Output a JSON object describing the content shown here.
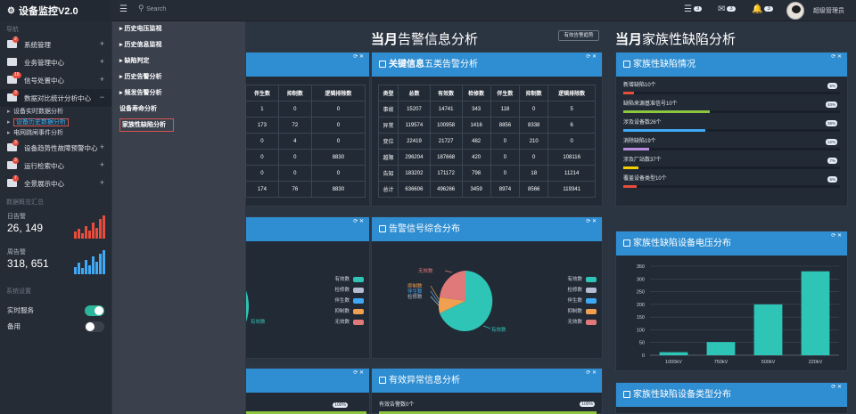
{
  "app": {
    "title": "设备监控V2.0",
    "search_placeholder": "Search"
  },
  "topbar": {
    "badges": [
      "3",
      "3",
      "3"
    ],
    "user": "超级管理员"
  },
  "sidebar": {
    "section_nav": "导航",
    "items": [
      {
        "label": "系统管理",
        "badge": "2"
      },
      {
        "label": "业务管理中心",
        "badge": ""
      },
      {
        "label": "信号处置中心",
        "badge": "15"
      },
      {
        "label": "数据对比统计分析中心",
        "badge": "3"
      }
    ],
    "subitems": [
      "设备实时数据分析",
      "设备历史数据分析",
      "电网跳闸事件分析"
    ],
    "items2": [
      {
        "label": "设备趋势性故障预警中心",
        "badge": "3"
      },
      {
        "label": "运行检索中心",
        "badge": "3"
      },
      {
        "label": "全景展示中心",
        "badge": "7"
      }
    ],
    "section_stats": "数据概览汇总",
    "stats": [
      {
        "label": "日告警",
        "value": "26, 149"
      },
      {
        "label": "周告警",
        "value": "318, 651"
      }
    ],
    "section_settings": "系统设置",
    "toggles": [
      {
        "label": "实时服务",
        "on": true
      },
      {
        "label": "备用",
        "on": false
      }
    ]
  },
  "dropdown": {
    "items": [
      "历史电压监视",
      "历史信息监视",
      "缺陷判定",
      "历史告警分析",
      "频发告警分析",
      "设备寿命分析",
      "家族性缺陷分析"
    ]
  },
  "left_panel": {
    "headers": [
      "伴生数",
      "抑制数",
      "逻辑排除数"
    ],
    "rows": [
      [
        "1",
        "0",
        "0"
      ],
      [
        "173",
        "72",
        "0"
      ],
      [
        "0",
        "4",
        "0"
      ],
      [
        "0",
        "0",
        "8830"
      ],
      [
        "0",
        "0",
        "0"
      ],
      [
        "174",
        "76",
        "8830"
      ]
    ],
    "bottom_pct": "100%",
    "legend_label": "有效数"
  },
  "middle": {
    "title_prefix": "当月",
    "title": "告警信息分析",
    "button": "有效告警趋势",
    "p1_title_bold": "关键信息",
    "p1_title": "五类告警分析",
    "table_headers": [
      "类型",
      "总数",
      "有效数",
      "检修数",
      "伴生数",
      "抑制数",
      "逻辑排除数"
    ],
    "table_rows": [
      [
        "事故",
        "15207",
        "14741",
        "343",
        "118",
        "0",
        "5"
      ],
      [
        "异常",
        "119574",
        "100958",
        "1416",
        "8856",
        "8338",
        "6"
      ],
      [
        "变位",
        "22419",
        "21727",
        "482",
        "0",
        "210",
        "0"
      ],
      [
        "越限",
        "296204",
        "187668",
        "420",
        "0",
        "0",
        "108116"
      ],
      [
        "告知",
        "183202",
        "171172",
        "798",
        "0",
        "18",
        "11214"
      ],
      [
        "总计",
        "636606",
        "496266",
        "3459",
        "8974",
        "8566",
        "119341"
      ]
    ],
    "p2_title": "告警信号综合分布",
    "pie_labels": [
      "无效数",
      "抑制数",
      "伴生数",
      "检修数",
      "有效数"
    ],
    "legend": [
      "有效数",
      "检修数",
      "伴生数",
      "抑制数",
      "无效数"
    ],
    "p3_title": "有效异常信息分析",
    "p3_line": "有效告警数0个",
    "p3_pct": "100%"
  },
  "right": {
    "title_prefix": "当月",
    "title": "家族性缺陷分析",
    "p1_title": "家族性缺陷情况",
    "defects": [
      {
        "label": "新增缺陷10个",
        "pct": "5%",
        "value": 5,
        "color": "#e74c3c"
      },
      {
        "label": "缺陷来源基准信号10个",
        "pct": "40%",
        "value": 40,
        "color": "#8dc63f"
      },
      {
        "label": "涉及设备数26个",
        "pct": "38%",
        "value": 38,
        "color": "#3fa9f5"
      },
      {
        "label": "消除缺陷19个",
        "pct": "12%",
        "value": 12,
        "color": "#b88be0"
      },
      {
        "label": "涉及厂站数37个",
        "pct": "7%",
        "value": 7,
        "color": "#f0d000"
      },
      {
        "label": "覆盖设备类型10个",
        "pct": "6%",
        "value": 6,
        "color": "#e74c3c"
      }
    ],
    "p2_title": "家族性缺陷设备电压分布",
    "p3_title": "家族性缺陷设备类型分布"
  },
  "chart_data": {
    "type": "bar",
    "categories": [
      "1000kV",
      "750kV",
      "500kV",
      "220kV"
    ],
    "values": [
      12,
      52,
      200,
      330
    ],
    "ylim": [
      0,
      350
    ],
    "yticks": [
      0,
      50,
      100,
      150,
      200,
      250,
      300,
      350
    ],
    "color": "#2ec4b6"
  },
  "colors": {
    "accent": "#2f8ed2",
    "teal": "#2ec4b6"
  }
}
